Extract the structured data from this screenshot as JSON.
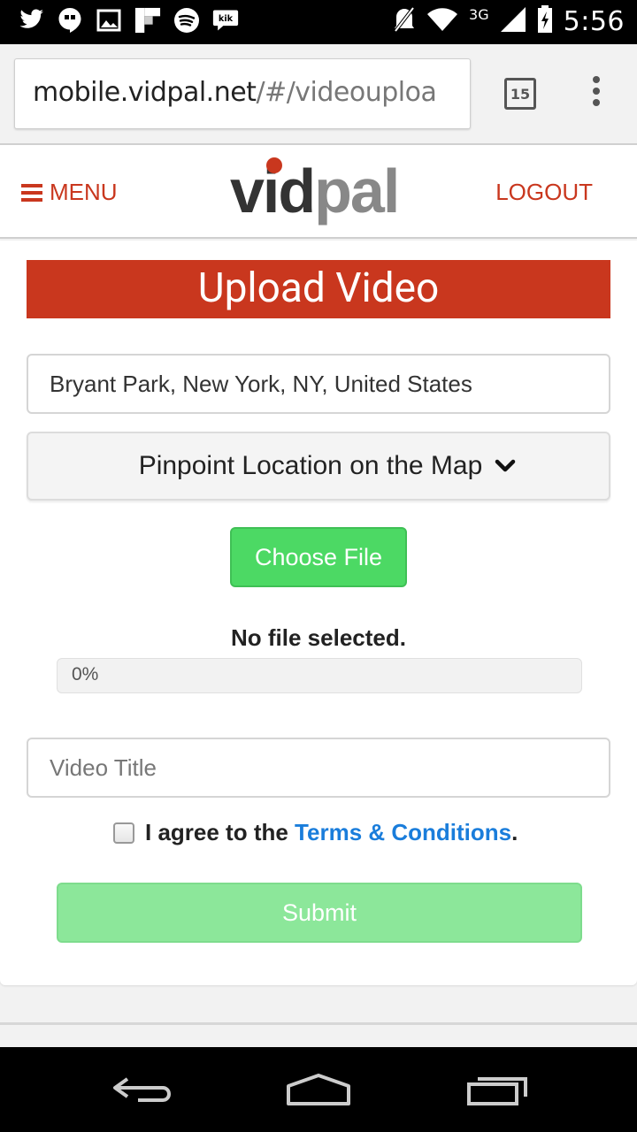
{
  "status_bar": {
    "left_icons": [
      "twitter-icon",
      "hangouts-icon",
      "gallery-icon",
      "flipboard-icon",
      "spotify-icon",
      "kik-icon"
    ],
    "network_label": "3G",
    "time": "5:56"
  },
  "browser": {
    "url_host": "mobile.vidpal.net",
    "url_path": "/#/videouploa",
    "tab_count": "15"
  },
  "nav": {
    "menu_label": "MENU",
    "logo_text": "vidpal",
    "logout_label": "LOGOUT"
  },
  "form": {
    "heading": "Upload Video",
    "location_value": "Bryant Park, New York, NY, United States",
    "pinpoint_label": "Pinpoint Location on the Map",
    "choose_file_label": "Choose File",
    "file_status": "No file selected.",
    "progress_text": "0%",
    "progress_fraction": 0,
    "title_placeholder": "Video Title",
    "agree_prefix": "I agree to the ",
    "terms_label": "Terms & Conditions",
    "agree_suffix": ".",
    "submit_label": "Submit"
  },
  "colors": {
    "brand_red": "#c9371e",
    "button_green": "#4cd964",
    "submit_disabled_green": "#8ce79a",
    "link_blue": "#1a7ddb"
  }
}
